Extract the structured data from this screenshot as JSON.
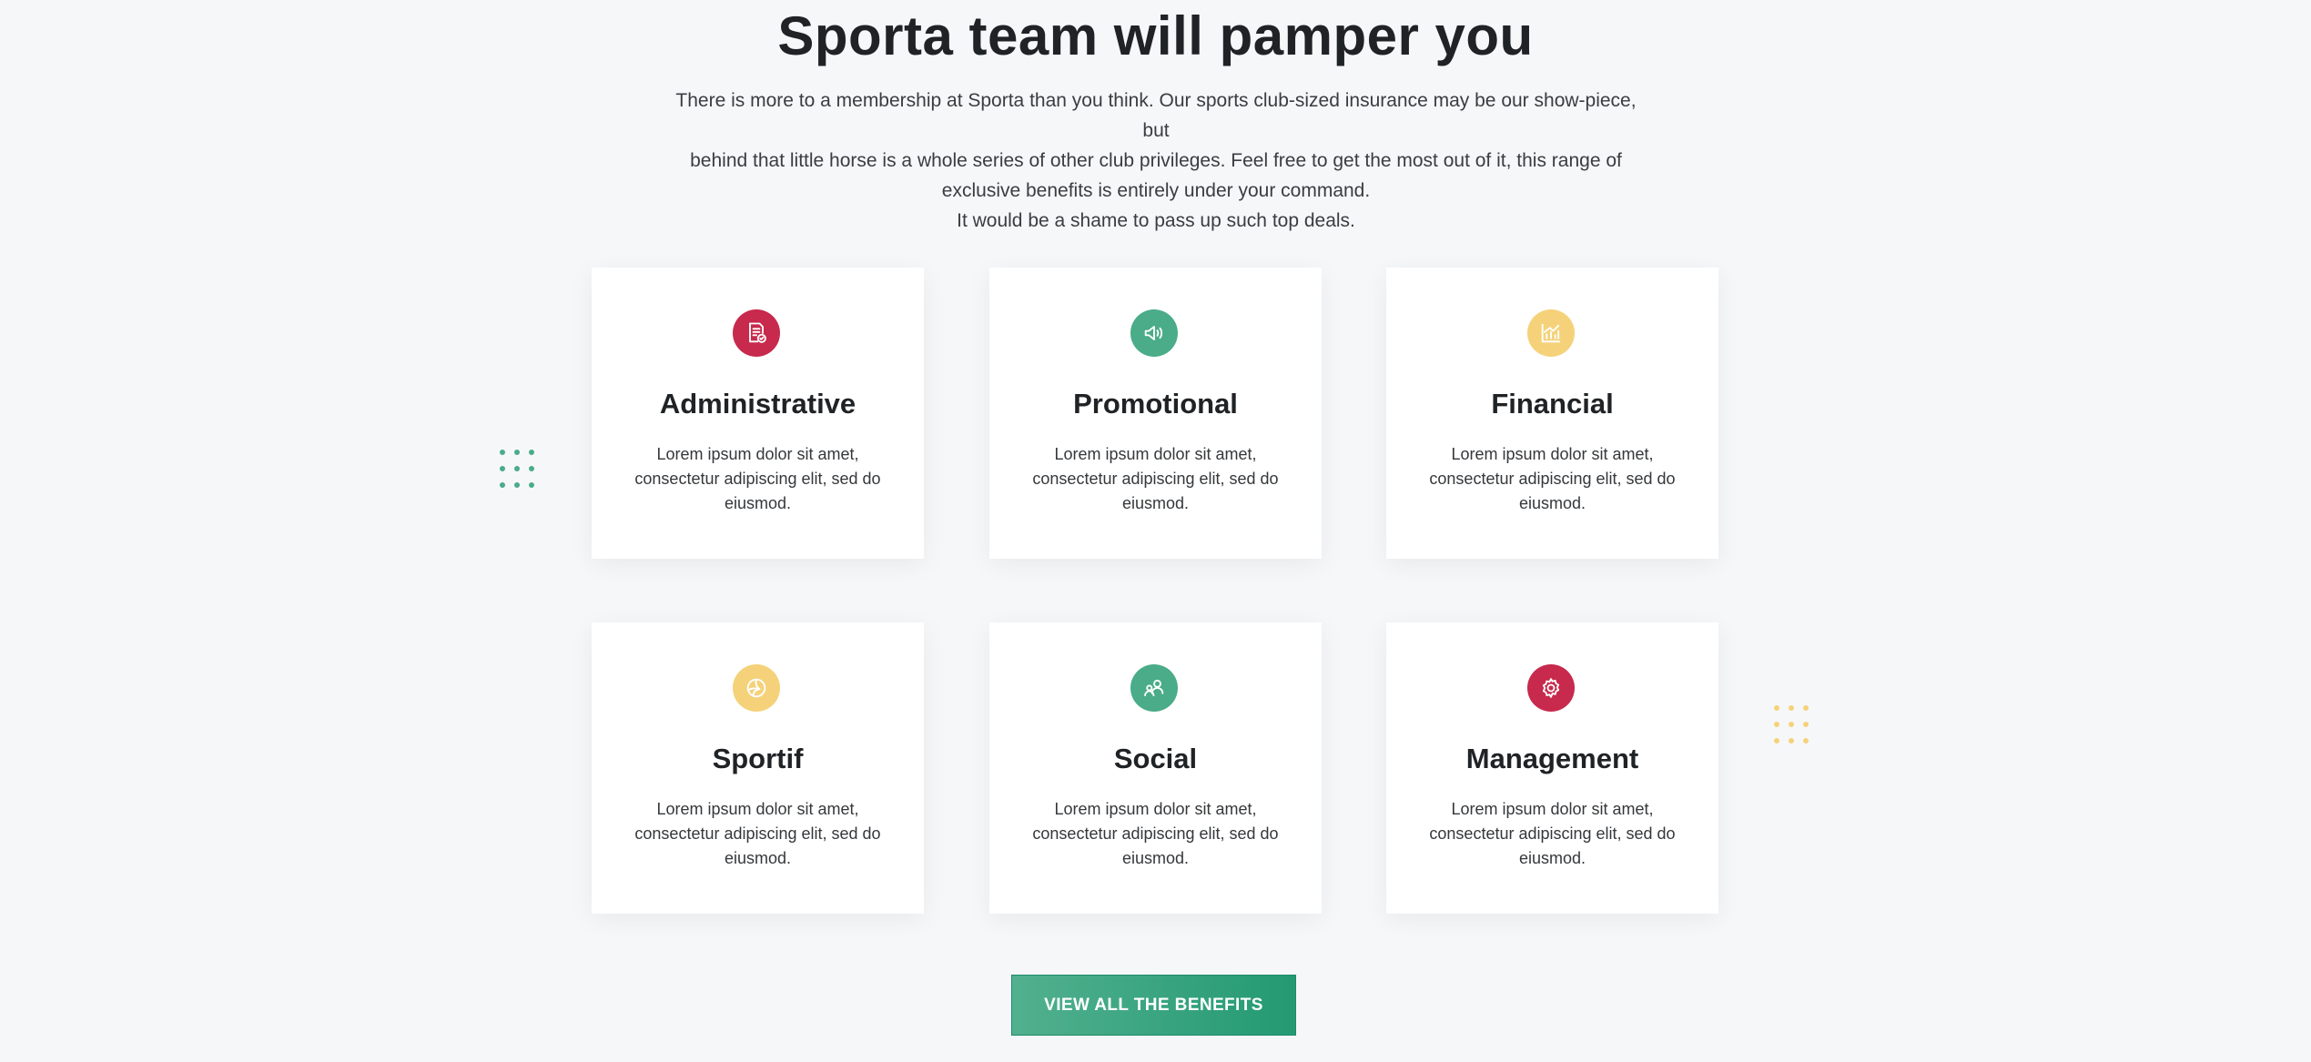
{
  "header": {
    "title": "Sporta team will pamper you",
    "intro_lines": [
      "There is more to a membership at Sporta than you think. Our sports club-sized insurance may be our show-piece, but",
      "behind that little horse is a whole series of other club privileges. Feel free to get the most out of it, this range of",
      "exclusive benefits is entirely under your command.",
      "It would be a shame to pass up such top deals."
    ]
  },
  "colors": {
    "red": "#c72a4c",
    "green": "#4aac88",
    "yellow": "#f5d27a",
    "button": "#2fa27b"
  },
  "cards": [
    {
      "title": "Administrative",
      "text": "Lorem ipsum dolor sit amet, consectetur adipiscing elit, sed do eiusmod.",
      "icon": "document-check-icon",
      "color": "#c72a4c"
    },
    {
      "title": "Promotional",
      "text": "Lorem ipsum dolor sit amet, consectetur adipiscing elit, sed do eiusmod.",
      "icon": "megaphone-icon",
      "color": "#4aac88"
    },
    {
      "title": "Financial",
      "text": "Lorem ipsum dolor sit amet, consectetur adipiscing elit, sed do eiusmod.",
      "icon": "chart-growth-icon",
      "color": "#f5d27a"
    },
    {
      "title": "Sportif",
      "text": "Lorem ipsum dolor sit amet, consectetur adipiscing elit, sed do eiusmod.",
      "icon": "volleyball-icon",
      "color": "#f5d27a"
    },
    {
      "title": "Social",
      "text": "Lorem ipsum dolor sit amet, consectetur adipiscing elit, sed do eiusmod.",
      "icon": "users-icon",
      "color": "#4aac88"
    },
    {
      "title": "Management",
      "text": "Lorem ipsum dolor sit amet, consectetur adipiscing elit, sed do eiusmod.",
      "icon": "gear-icon",
      "color": "#c72a4c"
    }
  ],
  "cta": {
    "label": "VIEW ALL THE BENEFITS"
  }
}
